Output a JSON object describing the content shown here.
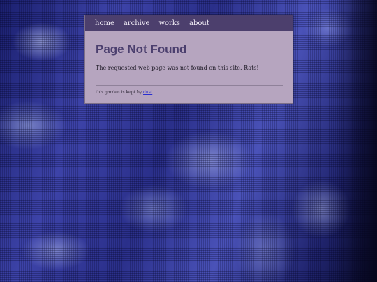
{
  "nav": {
    "items": [
      {
        "label": "home"
      },
      {
        "label": "archive"
      },
      {
        "label": "works"
      },
      {
        "label": "about"
      }
    ]
  },
  "main": {
    "title": "Page Not Found",
    "message": "The requested web page was not found on this site. Rats!"
  },
  "footer": {
    "text": "this garden is kept by ",
    "link_label": "dust"
  },
  "colors": {
    "nav_bg": "#4c3f6d",
    "panel_bg": "#b6a5bf",
    "title": "#4b3f6e",
    "link": "#2a2fd0"
  }
}
